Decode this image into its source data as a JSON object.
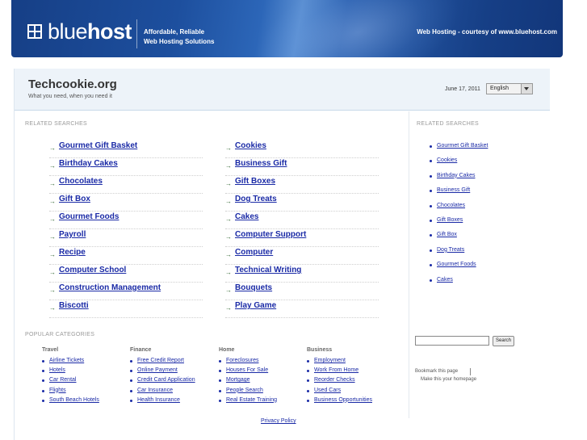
{
  "banner": {
    "logo_light": "blue",
    "logo_bold": "host",
    "tagline_1": "Affordable, Reliable",
    "tagline_2": "Web Hosting Solutions",
    "courtesy": "Web Hosting - courtesy of www.bluehost.com"
  },
  "header": {
    "title": "Techcookie.org",
    "subtitle": "What you need, when you need it",
    "date": "June 17, 2011",
    "language": "English"
  },
  "related": {
    "label": "RELATED SEARCHES",
    "left": [
      "Gourmet Gift Basket",
      "Birthday Cakes",
      "Chocolates",
      "Gift Box",
      "Gourmet Foods",
      "Payroll",
      "Recipe",
      "Computer School",
      "Construction Management",
      "Biscotti"
    ],
    "right": [
      "Cookies",
      "Business Gift",
      "Gift Boxes",
      "Dog Treats",
      "Cakes",
      "Computer Support",
      "Computer",
      "Technical Writing",
      "Bouquets",
      "Play Game"
    ]
  },
  "sidebar": {
    "label": "RELATED SEARCHES",
    "items": [
      "Gourmet Gift Basket",
      "Cookies",
      "Birthday Cakes",
      "Business Gift",
      "Chocolates",
      "Gift Boxes",
      "Gift Box",
      "Dog Treats",
      "Gourmet Foods",
      "Cakes"
    ],
    "search_button": "Search",
    "bookmark": "Bookmark this page",
    "homepage": "Make this your homepage"
  },
  "popular": {
    "label": "POPULAR CATEGORIES",
    "columns": [
      {
        "title": "Travel",
        "items": [
          "Airline Tickets",
          "Hotels",
          "Car Rental",
          "Flights",
          "South Beach Hotels"
        ]
      },
      {
        "title": "Finance",
        "items": [
          "Free Credit Report",
          "Online Payment",
          "Credit Card Application",
          "Car Insurance",
          "Health Insurance"
        ]
      },
      {
        "title": "Home",
        "items": [
          "Foreclosures",
          "Houses For Sale",
          "Mortgage",
          "People Search",
          "Real Estate Training"
        ]
      },
      {
        "title": "Business",
        "items": [
          "Employment",
          "Work From Home",
          "Reorder Checks",
          "Used Cars",
          "Business Opportunities"
        ]
      }
    ]
  },
  "footer": {
    "privacy": "Privacy Policy"
  }
}
